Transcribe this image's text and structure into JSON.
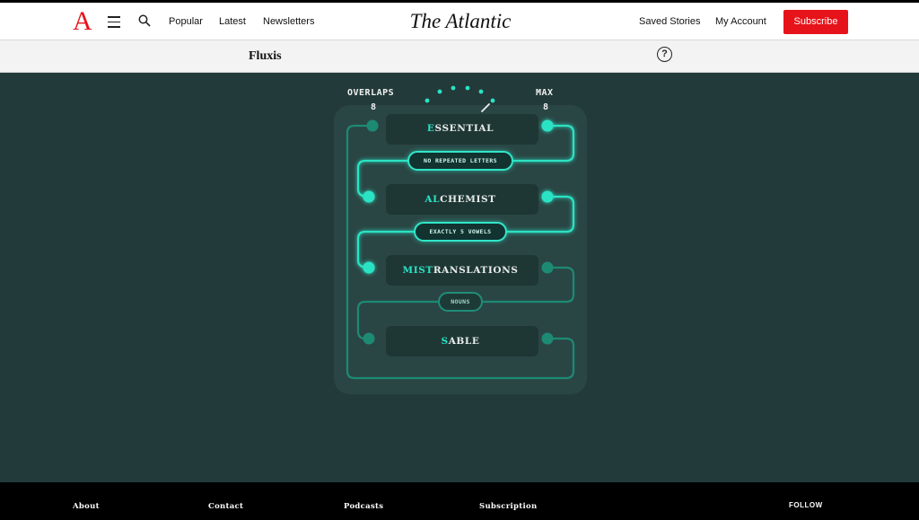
{
  "header": {
    "logo_letter": "A",
    "nav": [
      "Popular",
      "Latest",
      "Newsletters"
    ],
    "masthead": "The Atlantic",
    "saved_stories": "Saved Stories",
    "my_account": "My Account",
    "subscribe": "Subscribe",
    "brand_color": "#e7131a"
  },
  "subheader": {
    "game_title": "Fluxis",
    "help_label": "?"
  },
  "game": {
    "overlaps_label": "OVERLAPS",
    "overlaps_value": "8",
    "max_label": "MAX",
    "max_value": "8",
    "words": [
      {
        "highlight": "E",
        "rest": "SSENTIAL"
      },
      {
        "highlight": "AL",
        "rest": "CHEMIST"
      },
      {
        "highlight": "MIST",
        "rest": "RANSLATIONS"
      },
      {
        "highlight": "S",
        "rest": "ABLE"
      }
    ],
    "rules": [
      "NO REPEATED LETTERS",
      "EXACTLY 5 VOWELS",
      "NOUNS"
    ],
    "colors": {
      "background": "#233a3a",
      "accent": "#2be3c4",
      "dim": "#1d8a74"
    }
  },
  "footer": {
    "links": [
      "About",
      "Contact",
      "Podcasts",
      "Subscription"
    ],
    "follow": "FOLLOW"
  }
}
